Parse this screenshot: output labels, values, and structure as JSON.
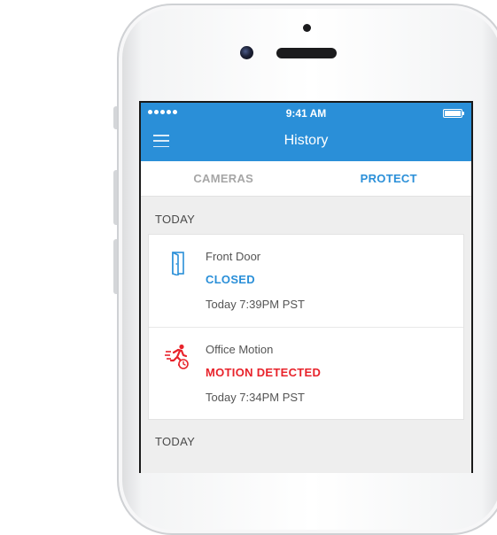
{
  "status_bar": {
    "time": "9:41 AM"
  },
  "header": {
    "title": "History",
    "menu_icon": "hamburger-menu-icon"
  },
  "tabs": [
    {
      "label": "CAMERAS",
      "active": false
    },
    {
      "label": "PROTECT",
      "active": true
    }
  ],
  "sections": [
    {
      "heading": "TODAY",
      "entries": [
        {
          "icon": "door-icon",
          "name": "Front Door",
          "state": "CLOSED",
          "state_color": "#2a8fd8",
          "time": "Today 7:39PM PST"
        },
        {
          "icon": "running-person-motion-icon",
          "name": "Office Motion",
          "state": "MOTION DETECTED",
          "state_color": "#e8232b",
          "time": "Today 7:34PM PST"
        }
      ]
    },
    {
      "heading": "TODAY",
      "entries": []
    }
  ],
  "colors": {
    "accent": "#2a8fd8",
    "alert": "#e8232b"
  }
}
